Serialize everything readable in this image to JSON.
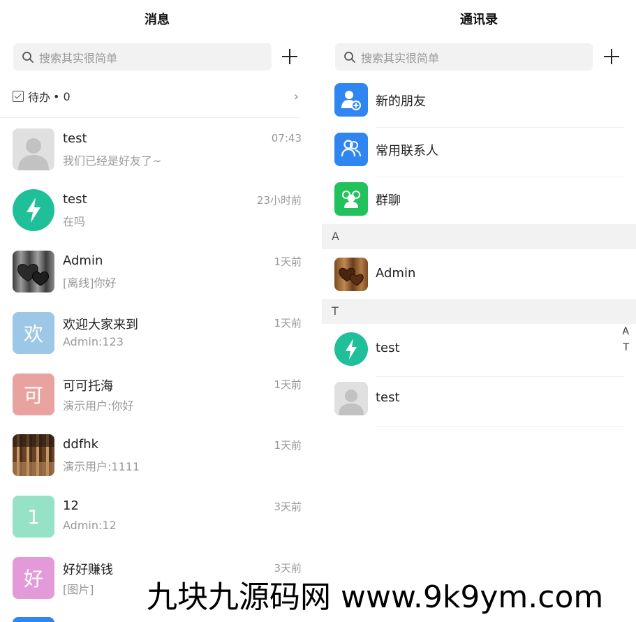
{
  "messages_panel": {
    "title": "消息",
    "search_placeholder": "搜索其实很简单",
    "todo": {
      "label": "待办",
      "count_text": "• 0"
    },
    "conversations": [
      {
        "name": "test",
        "time": "07:43",
        "preview": "我们已经是好友了~",
        "avatar": {
          "type": "default-user-icon",
          "color": "#e0e0e0"
        }
      },
      {
        "name": "test",
        "time": "23小时前",
        "preview": "在吗",
        "avatar": {
          "type": "lightning-icon",
          "color": "#1fbf9a"
        }
      },
      {
        "name": "Admin",
        "time": "1天前",
        "preview": "[离线]你好",
        "avatar": {
          "type": "hearts-photo",
          "color": "#555555"
        }
      },
      {
        "name": "欢迎大家来到",
        "time": "1天前",
        "preview": "Admin:123",
        "avatar": {
          "type": "letter",
          "letter": "欢",
          "color": "#9cc7e6"
        }
      },
      {
        "name": "可可托海",
        "time": "1天前",
        "preview": "演示用户:你好",
        "avatar": {
          "type": "letter",
          "letter": "可",
          "color": "#e8a3a0"
        }
      },
      {
        "name": "ddfhk",
        "time": "1天前",
        "preview": "演示用户:1111",
        "avatar": {
          "type": "food-photo",
          "color": "#8a5a3a"
        }
      },
      {
        "name": "12",
        "time": "3天前",
        "preview": "Admin:12",
        "avatar": {
          "type": "letter",
          "letter": "1",
          "color": "#96e2c6"
        }
      },
      {
        "name": "好好赚钱",
        "time": "3天前",
        "preview": "[图片]",
        "avatar": {
          "type": "letter",
          "letter": "好",
          "color": "#e39ad8"
        }
      }
    ]
  },
  "contacts_panel": {
    "title": "通讯录",
    "search_placeholder": "搜索其实很简单",
    "functions": [
      {
        "label": "新的朋友",
        "icon": "add-friend-icon",
        "color": "#2f86f0"
      },
      {
        "label": "常用联系人",
        "icon": "contacts-icon",
        "color": "#2f86f0"
      },
      {
        "label": "群聊",
        "icon": "group-chat-icon",
        "color": "#21c25c"
      }
    ],
    "sections": [
      {
        "letter": "A",
        "contacts": [
          {
            "label": "Admin",
            "avatar": "hearts-photo"
          }
        ]
      },
      {
        "letter": "T",
        "contacts": [
          {
            "label": "test",
            "avatar": "lightning-icon"
          },
          {
            "label": "test",
            "avatar": "default-user-icon"
          }
        ]
      }
    ],
    "index_letters": [
      "A",
      "T"
    ]
  },
  "watermark": "九块九源码网 www.9k9ym.com"
}
